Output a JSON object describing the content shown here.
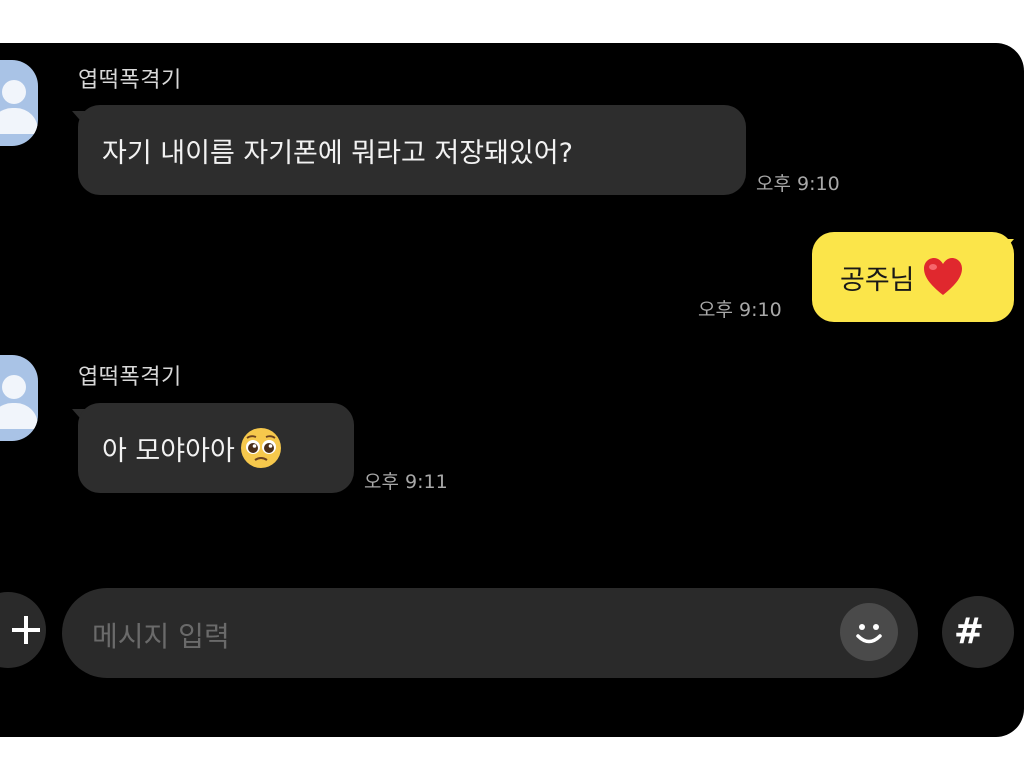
{
  "messages": [
    {
      "sender": "엽떡폭격기",
      "text": "자기 내이름 자기폰에 뭐라고 저장돼있어?",
      "time": "오후 9:10"
    },
    {
      "text": "공주님",
      "emoji": "heart-emoji",
      "time": "오후 9:10"
    },
    {
      "sender": "엽떡폭격기",
      "text": "아 모야아아",
      "emoji": "pleading-face-emoji",
      "time": "오후 9:11"
    }
  ],
  "input": {
    "placeholder": "메시지 입력"
  },
  "icons": {
    "add": "plus-icon",
    "emoticon": "smiley-icon",
    "hashtag": "#"
  },
  "colors": {
    "background": "#000000",
    "incoming_bubble": "#2d2d2d",
    "outgoing_bubble": "#fbe54a",
    "avatar": "#a9c3e6"
  }
}
